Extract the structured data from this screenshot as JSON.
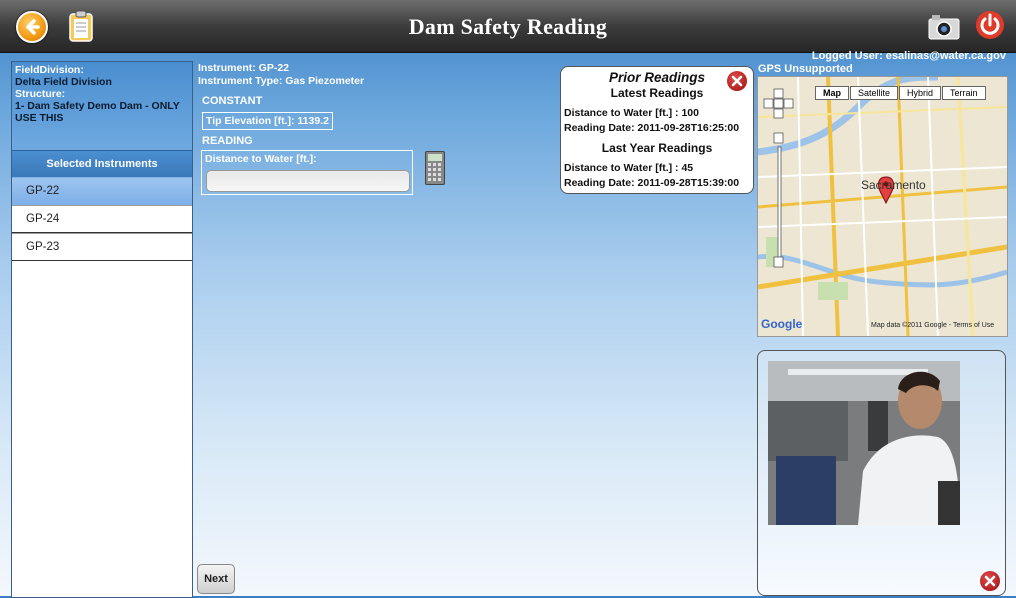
{
  "header": {
    "title": "Dam Safety Reading"
  },
  "user": {
    "logged": "Logged User: esalinas@water.ca.gov"
  },
  "sidebar": {
    "field_division_label": "FieldDivision:",
    "field_division_value": "Delta Field Division",
    "structure_label": "Structure:",
    "structure_value": "1- Dam Safety Demo Dam - ONLY USE THIS",
    "selected_header": "Selected Instruments",
    "items": [
      {
        "label": "GP-22"
      },
      {
        "label": "GP-24"
      },
      {
        "label": "GP-23"
      }
    ]
  },
  "main": {
    "instrument": "Instrument: GP-22",
    "instrument_type": "Instrument Type: Gas Piezometer",
    "constant_header": "CONSTANT",
    "tip_elevation": "Tip Elevation [ft.]: 1139.2",
    "reading_header": "READING",
    "distance_label": "Distance to Water [ft.]:",
    "distance_value": "",
    "next_label": "Next"
  },
  "prior": {
    "title": "Prior Readings",
    "latest_header": "Latest Readings",
    "latest_distance": "Distance to Water [ft.] : 100",
    "latest_date": "Reading Date: 2011-09-28T16:25:00",
    "last_year_header": "Last Year Readings",
    "last_year_distance": "Distance to Water [ft.] : 45",
    "last_year_date": "Reading Date: 2011-09-28T15:39:00"
  },
  "gps": {
    "status": "GPS Unsupported"
  },
  "map": {
    "types": [
      "Map",
      "Satellite",
      "Hybrid",
      "Terrain"
    ],
    "selected_type": "Map",
    "city": "Sacramento",
    "logo": "Google",
    "attribution": "Map data ©2011 Google - Terms of Use"
  },
  "colors": {
    "accent": "#4a8ed0",
    "selected": "#8db8ec",
    "close": "#b41a1a"
  }
}
